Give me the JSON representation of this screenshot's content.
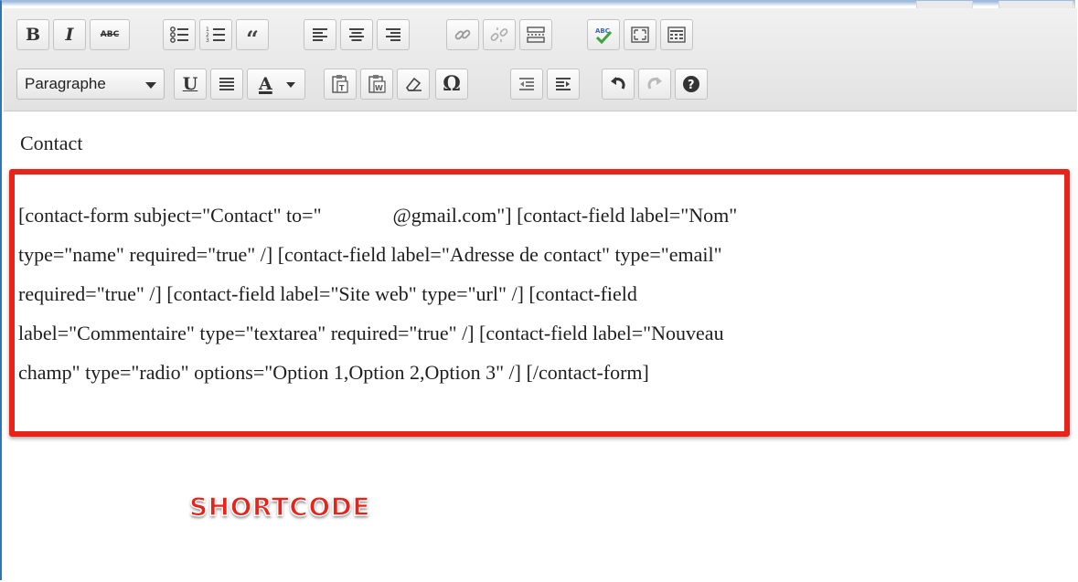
{
  "toolbar": {
    "row1": [
      {
        "name": "bold-button",
        "glyph": "B"
      },
      {
        "name": "italic-button",
        "glyph": "I"
      },
      {
        "name": "strikethrough-button",
        "glyph": "ABC"
      },
      {
        "name": "bullet-list-button",
        "glyph": ""
      },
      {
        "name": "numbered-list-button",
        "glyph": ""
      },
      {
        "name": "blockquote-button",
        "glyph": "“"
      },
      {
        "name": "align-left-button",
        "glyph": ""
      },
      {
        "name": "align-center-button",
        "glyph": ""
      },
      {
        "name": "align-right-button",
        "glyph": ""
      },
      {
        "name": "insert-link-button",
        "glyph": ""
      },
      {
        "name": "remove-link-button",
        "glyph": ""
      },
      {
        "name": "insert-more-button",
        "glyph": ""
      },
      {
        "name": "spellcheck-button",
        "glyph": "ABC"
      },
      {
        "name": "fullscreen-button",
        "glyph": ""
      },
      {
        "name": "kitchen-sink-button",
        "glyph": ""
      }
    ],
    "format_select": "Paragraphe",
    "underline": "U",
    "text_color": "A",
    "omega": "Ω"
  },
  "editor": {
    "title": "Contact",
    "shortcode_lines": [
      {
        "before": "[contact-form subject=\"Contact\" to=\"",
        "after": "@gmail.com\"] [contact-field label=\"Nom\""
      },
      {
        "text": "type=\"name\" required=\"true\" /] [contact-field label=\"Adresse de contact\" type=\"email\""
      },
      {
        "text": "required=\"true\" /] [contact-field label=\"Site web\" type=\"url\" /] [contact-field"
      },
      {
        "text": "label=\"Commentaire\" type=\"textarea\" required=\"true\" /] [contact-field label=\"Nouveau"
      },
      {
        "text": "champ\" type=\"radio\" options=\"Option 1,Option 2,Option 3\" /] [/contact-form]"
      }
    ],
    "annotation": "SHORTCODE"
  },
  "colors": {
    "highlight": "#e8231a",
    "toolbar_bg": "#e6e6e6",
    "frame_border": "#2f75b5"
  }
}
